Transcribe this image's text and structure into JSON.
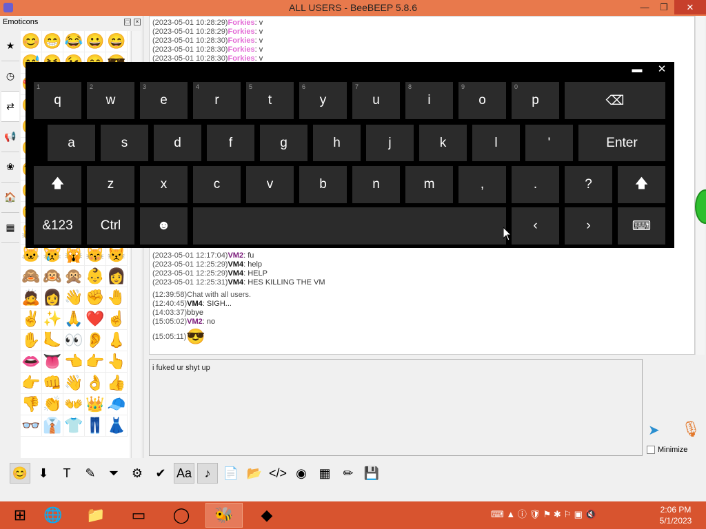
{
  "window": {
    "title": "ALL USERS - BeeBEEP 5.8.6",
    "min": "—",
    "max": "❐",
    "close": "✕"
  },
  "emoticons": {
    "header": "Emoticons",
    "tabs": [
      "★",
      "◷",
      "⇄",
      "📢",
      "❀",
      "🏠",
      "▦"
    ],
    "cells": [
      "😊",
      "😁",
      "😂",
      "😀",
      "😄",
      "😅",
      "😆",
      "😉",
      "😋",
      "😎",
      "😍",
      "😘",
      "😗",
      "😙",
      "😚",
      "🙂",
      "🤗",
      "🤩",
      "🤔",
      "🤨",
      "😐",
      "😑",
      "😶",
      "🙄",
      "😏",
      "😣",
      "😥",
      "😮",
      "🤐",
      "😯",
      "😪",
      "😫",
      "😴",
      "😌",
      "😛",
      "😜",
      "😝",
      "🤤",
      "😒",
      "😓",
      "😔",
      "😕",
      "🙃",
      "🤑",
      "😲",
      "😺",
      "😸",
      "😹",
      "😻",
      "😼",
      "🐱",
      "😿",
      "🙀",
      "😽",
      "😾",
      "🙈",
      "🙉",
      "🙊",
      "👶",
      "👩",
      "🙇",
      "👩",
      "👋",
      "✊",
      "🤚",
      "✌",
      "✨",
      "🙏",
      "❤️",
      "☝",
      "✋",
      "🦶",
      "👀",
      "👂",
      "👃",
      "👄",
      "👅",
      "👈",
      "👉",
      "👆",
      "👉",
      "👊",
      "👋",
      "👌",
      "👍",
      "👎",
      "👏",
      "👐",
      "👑",
      "🧢",
      "👓",
      "👔",
      "👕",
      "👖",
      "👗"
    ]
  },
  "chat": {
    "top_messages": [
      {
        "ts": "(2023-05-01 10:28:29)",
        "nick": "Forkies",
        "text": ": v"
      },
      {
        "ts": "(2023-05-01 10:28:29)",
        "nick": "Forkies",
        "text": ": v"
      },
      {
        "ts": "(2023-05-01 10:28:30)",
        "nick": "Forkies",
        "text": ": v"
      },
      {
        "ts": "(2023-05-01 10:28:30)",
        "nick": "Forkies",
        "text": ": v"
      },
      {
        "ts": "(2023-05-01 10:28:30)",
        "nick": "Forkies",
        "text": ": v"
      }
    ],
    "bottom_messages": [
      {
        "ts": "(2023-05-01 12:17:04)",
        "nick": "VM2",
        "text": ": fu",
        "color": "#7a1a7a"
      },
      {
        "ts": "(2023-05-01 12:25:29)",
        "nick": "VM4",
        "text": ": help",
        "color": "#111"
      },
      {
        "ts": "(2023-05-01 12:25:29)",
        "nick": "VM4",
        "text": ": HELP",
        "color": "#111"
      },
      {
        "ts": "(2023-05-01 12:25:31)",
        "nick": "VM4",
        "text": ": HES KILLING THE VM",
        "color": "#111"
      }
    ],
    "system_ts": "(12:39:58)",
    "system_text": "Chat with all users.",
    "m2_ts": "(12:40:45)",
    "m2_nick": "VM4",
    "m2_text": ": SIGH...",
    "m3_ts": "(14:03:37)",
    "m3_text": "bbye",
    "m4_ts": "(15:05:02)",
    "m4_nick": "VM2",
    "m4_text": ": no",
    "m5_ts": "(15:05:11)",
    "m5_emoji": "😎"
  },
  "input": {
    "value": "i fuked ur shyt up"
  },
  "minimize_label": "Minimize",
  "keyboard": {
    "row1": [
      {
        "k": "q",
        "n": "1"
      },
      {
        "k": "w",
        "n": "2"
      },
      {
        "k": "e",
        "n": "3"
      },
      {
        "k": "r",
        "n": "4"
      },
      {
        "k": "t",
        "n": "5"
      },
      {
        "k": "y",
        "n": "6"
      },
      {
        "k": "u",
        "n": "7"
      },
      {
        "k": "i",
        "n": "8"
      },
      {
        "k": "o",
        "n": "9"
      },
      {
        "k": "p",
        "n": "0"
      }
    ],
    "backspace": "⌫",
    "row2": [
      "a",
      "s",
      "d",
      "f",
      "g",
      "h",
      "j",
      "k",
      "l",
      "'"
    ],
    "enter": "Enter",
    "shift": "🡅",
    "row3": [
      "z",
      "x",
      "c",
      "v",
      "b",
      "n",
      "m",
      ",",
      ".",
      "?"
    ],
    "num_key": "&123",
    "ctrl_key": "Ctrl",
    "emoji_key": "☻",
    "left_key": "‹",
    "right_key": "›",
    "kbd_key": "⌨",
    "osk_min": "▬",
    "osk_close": "✕"
  },
  "toolbar": [
    "😊",
    "⬇",
    "T",
    "✎",
    "⏷",
    "⚙",
    "✔",
    "Aa",
    "♪",
    "📄",
    "📂",
    "</>",
    "◉",
    "▦",
    "✏",
    "💾"
  ],
  "taskbar": {
    "apps": [
      "⊞",
      "🌐",
      "📁",
      "▭",
      "◯",
      "🐝",
      "◆"
    ],
    "tray": "⌨  ▲  ⓘ  🛡  ⚑  ✱  ⚐  ▣  🔇",
    "time": "2:06 PM",
    "date": "5/1/2023"
  }
}
